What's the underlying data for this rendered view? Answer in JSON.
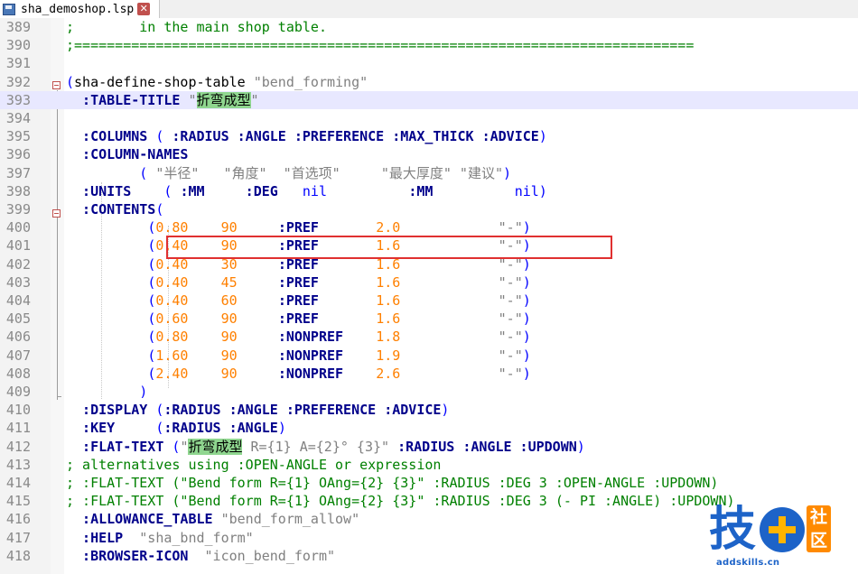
{
  "tab": {
    "filename": "sha_demoshop.lsp",
    "close_label": "✕"
  },
  "watermark": {
    "char": "技",
    "badge_top": "社",
    "badge_bottom": "区",
    "url": "addskills.cn"
  },
  "lines": [
    {
      "num": "389",
      "segments": [
        {
          "c": "c",
          "t": ";        in the main shop table."
        }
      ]
    },
    {
      "num": "390",
      "segments": [
        {
          "c": "c",
          "t": ";============================================================================"
        }
      ]
    },
    {
      "num": "391",
      "segments": []
    },
    {
      "num": "392",
      "segments": [
        {
          "c": "p",
          "t": "("
        },
        {
          "c": "t",
          "t": "sha-define-shop-table "
        },
        {
          "c": "s",
          "t": "\"bend_forming\""
        }
      ]
    },
    {
      "num": "393",
      "segments": [
        {
          "c": "k",
          "t": "  :TABLE-TITLE "
        },
        {
          "c": "s",
          "t": "\""
        },
        {
          "c": "hl",
          "t": "折弯成型"
        },
        {
          "c": "s",
          "t": "\""
        }
      ]
    },
    {
      "num": "394",
      "segments": []
    },
    {
      "num": "395",
      "segments": [
        {
          "c": "k",
          "t": "  :COLUMNS "
        },
        {
          "c": "p",
          "t": "( "
        },
        {
          "c": "k",
          "t": ":RADIUS :ANGLE :PREFERENCE :MAX_THICK :ADVICE"
        },
        {
          "c": "p",
          "t": ")"
        }
      ]
    },
    {
      "num": "396",
      "segments": [
        {
          "c": "k",
          "t": "  :COLUMN-NAMES"
        }
      ]
    },
    {
      "num": "397",
      "segments": [
        {
          "c": "t",
          "t": "         "
        },
        {
          "c": "p",
          "t": "( "
        },
        {
          "c": "s",
          "t": "\"半径\"   \"角度\"  \"首选项\"     \"最大厚度\" \"建议\""
        },
        {
          "c": "p",
          "t": ")"
        }
      ]
    },
    {
      "num": "398",
      "segments": [
        {
          "c": "k",
          "t": "  :UNITS    "
        },
        {
          "c": "p",
          "t": "( "
        },
        {
          "c": "k",
          "t": ":MM     :DEG   "
        },
        {
          "c": "p",
          "t": "nil"
        },
        {
          "c": "t",
          "t": "          "
        },
        {
          "c": "k",
          "t": ":MM"
        },
        {
          "c": "t",
          "t": "          "
        },
        {
          "c": "p",
          "t": "nil)"
        }
      ]
    },
    {
      "num": "399",
      "segments": [
        {
          "c": "k",
          "t": "  :CONTENTS"
        },
        {
          "c": "p",
          "t": "("
        }
      ]
    },
    {
      "num": "400",
      "segments": [
        {
          "c": "t",
          "t": "          "
        },
        {
          "c": "p",
          "t": "("
        },
        {
          "c": "n",
          "t": "0.80    90"
        },
        {
          "c": "t",
          "t": "     "
        },
        {
          "c": "k",
          "t": ":PREF"
        },
        {
          "c": "t",
          "t": "       "
        },
        {
          "c": "n",
          "t": "2.0"
        },
        {
          "c": "t",
          "t": "            "
        },
        {
          "c": "s",
          "t": "\"-\""
        },
        {
          "c": "p",
          "t": ")"
        }
      ]
    },
    {
      "num": "401",
      "segments": [
        {
          "c": "t",
          "t": "          "
        },
        {
          "c": "p",
          "t": "("
        },
        {
          "c": "n",
          "t": "0.40    90"
        },
        {
          "c": "t",
          "t": "     "
        },
        {
          "c": "k",
          "t": ":PREF"
        },
        {
          "c": "t",
          "t": "       "
        },
        {
          "c": "n",
          "t": "1.6"
        },
        {
          "c": "t",
          "t": "            "
        },
        {
          "c": "s",
          "t": "\"-\""
        },
        {
          "c": "p",
          "t": ")"
        }
      ]
    },
    {
      "num": "402",
      "segments": [
        {
          "c": "t",
          "t": "          "
        },
        {
          "c": "p",
          "t": "("
        },
        {
          "c": "n",
          "t": "0.40    30"
        },
        {
          "c": "t",
          "t": "     "
        },
        {
          "c": "k",
          "t": ":PREF"
        },
        {
          "c": "t",
          "t": "       "
        },
        {
          "c": "n",
          "t": "1.6"
        },
        {
          "c": "t",
          "t": "            "
        },
        {
          "c": "s",
          "t": "\"-\""
        },
        {
          "c": "p",
          "t": ")"
        }
      ]
    },
    {
      "num": "403",
      "segments": [
        {
          "c": "t",
          "t": "          "
        },
        {
          "c": "p",
          "t": "("
        },
        {
          "c": "n",
          "t": "0.40    45"
        },
        {
          "c": "t",
          "t": "     "
        },
        {
          "c": "k",
          "t": ":PREF"
        },
        {
          "c": "t",
          "t": "       "
        },
        {
          "c": "n",
          "t": "1.6"
        },
        {
          "c": "t",
          "t": "            "
        },
        {
          "c": "s",
          "t": "\"-\""
        },
        {
          "c": "p",
          "t": ")"
        }
      ]
    },
    {
      "num": "404",
      "segments": [
        {
          "c": "t",
          "t": "          "
        },
        {
          "c": "p",
          "t": "("
        },
        {
          "c": "n",
          "t": "0.40    60"
        },
        {
          "c": "t",
          "t": "     "
        },
        {
          "c": "k",
          "t": ":PREF"
        },
        {
          "c": "t",
          "t": "       "
        },
        {
          "c": "n",
          "t": "1.6"
        },
        {
          "c": "t",
          "t": "            "
        },
        {
          "c": "s",
          "t": "\"-\""
        },
        {
          "c": "p",
          "t": ")"
        }
      ]
    },
    {
      "num": "405",
      "segments": [
        {
          "c": "t",
          "t": "          "
        },
        {
          "c": "p",
          "t": "("
        },
        {
          "c": "n",
          "t": "0.60    90"
        },
        {
          "c": "t",
          "t": "     "
        },
        {
          "c": "k",
          "t": ":PREF"
        },
        {
          "c": "t",
          "t": "       "
        },
        {
          "c": "n",
          "t": "1.6"
        },
        {
          "c": "t",
          "t": "            "
        },
        {
          "c": "s",
          "t": "\"-\""
        },
        {
          "c": "p",
          "t": ")"
        }
      ]
    },
    {
      "num": "406",
      "segments": [
        {
          "c": "t",
          "t": "          "
        },
        {
          "c": "p",
          "t": "("
        },
        {
          "c": "n",
          "t": "0.80    90"
        },
        {
          "c": "t",
          "t": "     "
        },
        {
          "c": "k",
          "t": ":NONPREF"
        },
        {
          "c": "t",
          "t": "    "
        },
        {
          "c": "n",
          "t": "1.8"
        },
        {
          "c": "t",
          "t": "            "
        },
        {
          "c": "s",
          "t": "\"-\""
        },
        {
          "c": "p",
          "t": ")"
        }
      ]
    },
    {
      "num": "407",
      "segments": [
        {
          "c": "t",
          "t": "          "
        },
        {
          "c": "p",
          "t": "("
        },
        {
          "c": "n",
          "t": "1.60    90"
        },
        {
          "c": "t",
          "t": "     "
        },
        {
          "c": "k",
          "t": ":NONPREF"
        },
        {
          "c": "t",
          "t": "    "
        },
        {
          "c": "n",
          "t": "1.9"
        },
        {
          "c": "t",
          "t": "            "
        },
        {
          "c": "s",
          "t": "\"-\""
        },
        {
          "c": "p",
          "t": ")"
        }
      ]
    },
    {
      "num": "408",
      "segments": [
        {
          "c": "t",
          "t": "          "
        },
        {
          "c": "p",
          "t": "("
        },
        {
          "c": "n",
          "t": "2.40    90"
        },
        {
          "c": "t",
          "t": "     "
        },
        {
          "c": "k",
          "t": ":NONPREF"
        },
        {
          "c": "t",
          "t": "    "
        },
        {
          "c": "n",
          "t": "2.6"
        },
        {
          "c": "t",
          "t": "            "
        },
        {
          "c": "s",
          "t": "\"-\""
        },
        {
          "c": "p",
          "t": ")"
        }
      ]
    },
    {
      "num": "409",
      "segments": [
        {
          "c": "t",
          "t": "         "
        },
        {
          "c": "p",
          "t": ")"
        }
      ]
    },
    {
      "num": "410",
      "segments": [
        {
          "c": "k",
          "t": "  :DISPLAY "
        },
        {
          "c": "p",
          "t": "("
        },
        {
          "c": "k",
          "t": ":RADIUS :ANGLE :PREFERENCE :ADVICE"
        },
        {
          "c": "p",
          "t": ")"
        }
      ]
    },
    {
      "num": "411",
      "segments": [
        {
          "c": "k",
          "t": "  :KEY     "
        },
        {
          "c": "p",
          "t": "("
        },
        {
          "c": "k",
          "t": ":RADIUS :ANGLE"
        },
        {
          "c": "p",
          "t": ")"
        }
      ]
    },
    {
      "num": "412",
      "segments": [
        {
          "c": "k",
          "t": "  :FLAT-TEXT "
        },
        {
          "c": "p",
          "t": "("
        },
        {
          "c": "s",
          "t": "\""
        },
        {
          "c": "hl",
          "t": "折弯成型"
        },
        {
          "c": "s",
          "t": " R={1} A={2}° {3}\""
        },
        {
          "c": "t",
          "t": " "
        },
        {
          "c": "k",
          "t": ":RADIUS :ANGLE :UPDOWN"
        },
        {
          "c": "p",
          "t": ")"
        }
      ]
    },
    {
      "num": "413",
      "segments": [
        {
          "c": "c",
          "t": "; alternatives using :OPEN-ANGLE or expression"
        }
      ]
    },
    {
      "num": "414",
      "segments": [
        {
          "c": "c",
          "t": "; :FLAT-TEXT (\"Bend form R={1} OAng={2} {3}\" :RADIUS :DEG 3 :OPEN-ANGLE :UPDOWN)"
        }
      ]
    },
    {
      "num": "415",
      "segments": [
        {
          "c": "c",
          "t": "; :FLAT-TEXT (\"Bend form R={1} OAng={2} {3}\" :RADIUS :DEG 3 (- PI :ANGLE) :UPDOWN)"
        }
      ]
    },
    {
      "num": "416",
      "segments": [
        {
          "c": "k",
          "t": "  :ALLOWANCE_TABLE "
        },
        {
          "c": "s",
          "t": "\"bend_form_allow\""
        }
      ]
    },
    {
      "num": "417",
      "segments": [
        {
          "c": "k",
          "t": "  :HELP  "
        },
        {
          "c": "s",
          "t": "\"sha_bnd_form\""
        }
      ]
    },
    {
      "num": "418",
      "segments": [
        {
          "c": "k",
          "t": "  :BROWSER-ICON  "
        },
        {
          "c": "s",
          "t": "\"icon_bend_form\""
        }
      ]
    }
  ]
}
